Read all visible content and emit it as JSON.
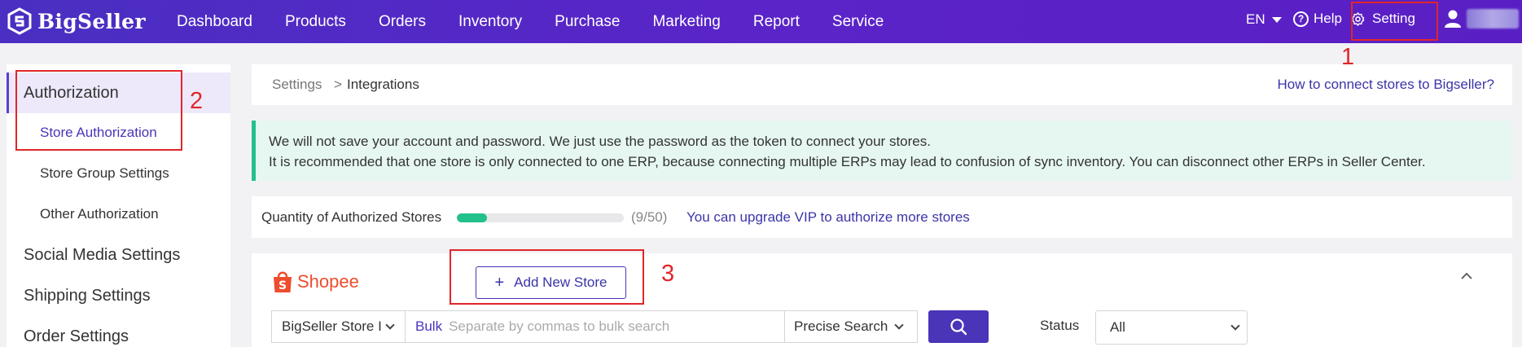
{
  "brand": {
    "name": "BigSeller"
  },
  "nav": {
    "items": [
      "Dashboard",
      "Products",
      "Orders",
      "Inventory",
      "Purchase",
      "Marketing",
      "Report",
      "Service"
    ],
    "lang": "EN",
    "help": "Help",
    "setting": "Setting"
  },
  "sidebar": {
    "authorization": "Authorization",
    "store_authorization": "Store Authorization",
    "store_group_settings": "Store Group Settings",
    "other_authorization": "Other Authorization",
    "social_media_settings": "Social Media Settings",
    "shipping_settings": "Shipping Settings",
    "order_settings": "Order Settings"
  },
  "annotations": {
    "one": "1",
    "two": "2",
    "three": "3"
  },
  "breadcrumb": {
    "root": "Settings",
    "separator": ">",
    "current": "Integrations",
    "help_link": "How to connect stores to Bigseller?"
  },
  "notice": {
    "line1": "We will not save your account and password. We just use the password as the token to connect your stores.",
    "line2": "It is recommended that one store is only connected to one ERP, because connecting multiple ERPs may lead to confusion of sync inventory. You can disconnect other ERPs in Seller Center."
  },
  "quota": {
    "label": "Quantity of Authorized Stores",
    "count": "(9/50)",
    "used": 9,
    "total": 50,
    "upgrade_link": "You can upgrade VIP to authorize more stores"
  },
  "shop": {
    "platform": "Shopee",
    "add_button": "Add New Store",
    "add_plus": "+",
    "filter_field": "BigSeller Store I",
    "bulk_label": "Bulk",
    "bulk_placeholder": "Separate by commas to bulk search",
    "match_mode": "Precise Search",
    "status_label": "Status",
    "status_value": "All"
  },
  "colors": {
    "nav_bg": "#5224c6",
    "accent": "#4a35b8",
    "success": "#22c08a",
    "annotation_red": "#e0262a",
    "shopee_orange": "#ee4d2d"
  }
}
